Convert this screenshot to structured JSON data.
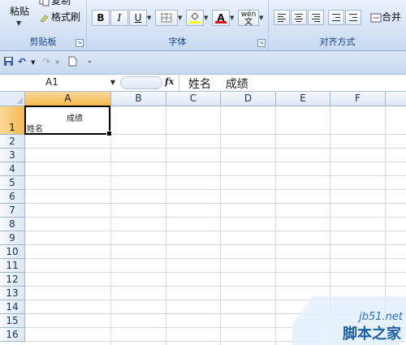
{
  "ribbon": {
    "clipboard": {
      "paste_label": "粘贴",
      "copy_label": "复制",
      "format_painter_label": "格式刷",
      "group_label": "剪贴板"
    },
    "font": {
      "bold": "B",
      "italic": "I",
      "underline": "U",
      "font_color_glyph": "A",
      "phonetic_glyph": "wén",
      "group_label": "字体"
    },
    "alignment": {
      "merge_label": "合并",
      "group_label": "对齐方式"
    }
  },
  "formula_bar": {
    "name_box": "A1",
    "fx": "fx",
    "content": "姓名    成绩"
  },
  "grid": {
    "columns": [
      "A",
      "B",
      "C",
      "D",
      "E",
      "F"
    ],
    "rows": [
      "1",
      "2",
      "3",
      "4",
      "5",
      "6",
      "7",
      "8",
      "9",
      "10",
      "11",
      "12",
      "13",
      "14",
      "15",
      "16"
    ],
    "selected_cell": "A1",
    "cell_a1": {
      "line1": "成绩",
      "line2": "姓名"
    }
  },
  "watermark": {
    "url": "jb51.net",
    "name": "脚本之家"
  },
  "colors": {
    "ribbon": "#d5e3f5",
    "selection_header": "#f6b94f",
    "gridline": "#d0d7e5"
  }
}
